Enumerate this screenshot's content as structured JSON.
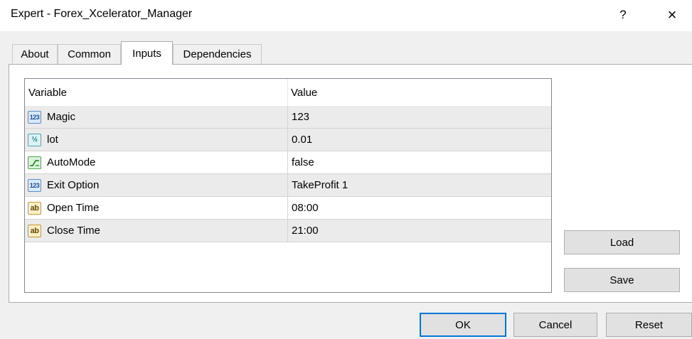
{
  "window": {
    "title": "Expert - Forex_Xcelerator_Manager",
    "help_label": "?",
    "close_label": "×"
  },
  "tabs": [
    {
      "label": "About"
    },
    {
      "label": "Common"
    },
    {
      "label": "Inputs",
      "active": true
    },
    {
      "label": "Dependencies"
    }
  ],
  "grid": {
    "columns": [
      "Variable",
      "Value"
    ],
    "rows": [
      {
        "variable": "Magic",
        "value": "123",
        "type_icon": "integer-type-icon",
        "icon_text": "123"
      },
      {
        "variable": "lot",
        "value": "0.01",
        "type_icon": "double-type-icon",
        "icon_text": "½"
      },
      {
        "variable": "AutoMode",
        "value": "false",
        "type_icon": "boolean-type-icon",
        "icon_text": ""
      },
      {
        "variable": "Exit Option",
        "value": "TakeProfit 1",
        "type_icon": "enum-type-icon",
        "icon_text": "123"
      },
      {
        "variable": "Open Time",
        "value": "08:00",
        "type_icon": "string-type-icon",
        "icon_text": "ab"
      },
      {
        "variable": "Close Time",
        "value": "21:00",
        "type_icon": "string-type-icon",
        "icon_text": "ab"
      }
    ]
  },
  "side_buttons": {
    "load": "Load",
    "save": "Save"
  },
  "footer_buttons": {
    "ok": "OK",
    "cancel": "Cancel",
    "reset": "Reset"
  },
  "colors": {
    "focus_border": "#0078d7",
    "alt_row": "#ebebeb",
    "panel_border": "#adadad"
  }
}
